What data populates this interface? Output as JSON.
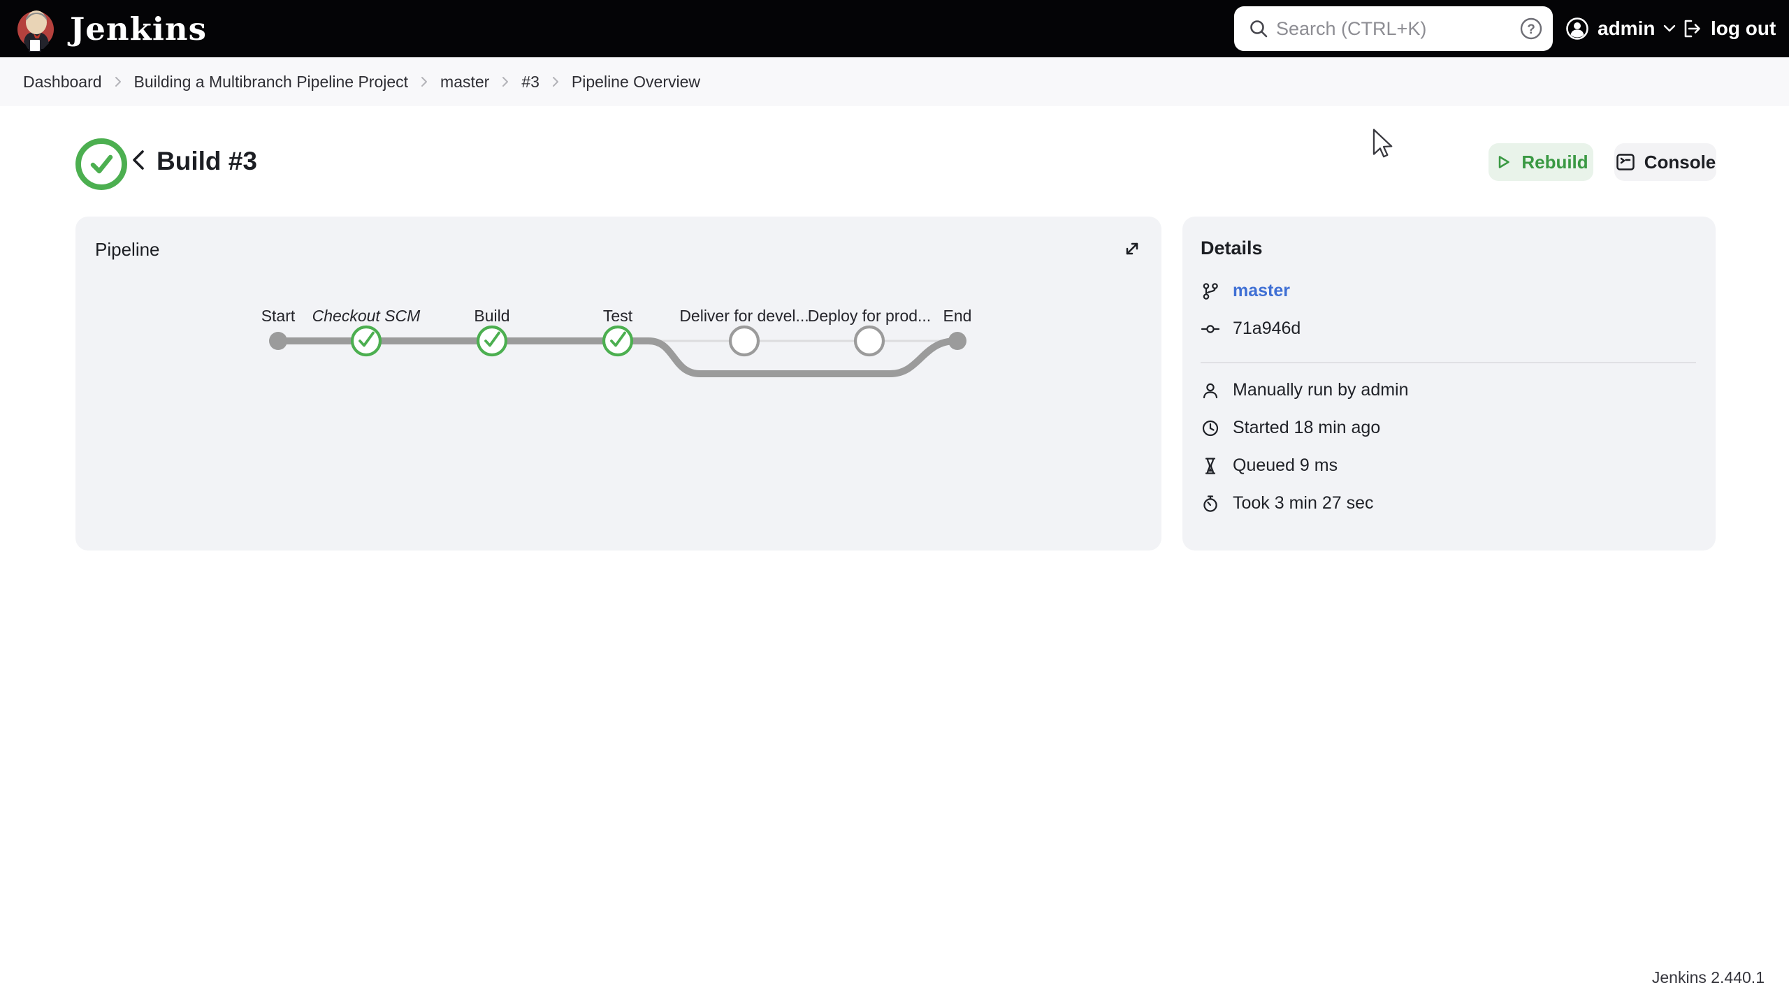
{
  "header": {
    "brand": "Jenkins",
    "search": {
      "placeholder": "Search (CTRL+K)"
    },
    "user": {
      "name": "admin"
    },
    "logout_label": "log out"
  },
  "breadcrumbs": {
    "items": [
      {
        "label": "Dashboard"
      },
      {
        "label": "Building a Multibranch Pipeline Project"
      },
      {
        "label": "master"
      },
      {
        "label": "#3"
      },
      {
        "label": "Pipeline Overview"
      }
    ]
  },
  "page": {
    "title": "Build #3",
    "status": "success",
    "rebuild_label": "Rebuild",
    "console_label": "Console"
  },
  "pipeline": {
    "title": "Pipeline",
    "stages": [
      {
        "label": "Start",
        "type": "terminal"
      },
      {
        "label": "Checkout SCM",
        "status": "success",
        "italic": true
      },
      {
        "label": "Build",
        "status": "success"
      },
      {
        "label": "Test",
        "status": "success"
      },
      {
        "label": "Deliver for devel...",
        "status": "skipped"
      },
      {
        "label": "Deploy for prod...",
        "status": "skipped"
      },
      {
        "label": "End",
        "type": "terminal"
      }
    ]
  },
  "details": {
    "title": "Details",
    "branch": "master",
    "commit": "71a946d",
    "rows": [
      {
        "icon": "user-icon",
        "text": "Manually run by admin"
      },
      {
        "icon": "clock-icon",
        "text": "Started 18 min ago"
      },
      {
        "icon": "hourglass-icon",
        "text": "Queued 9 ms"
      },
      {
        "icon": "stopwatch-icon",
        "text": "Took 3 min 27 sec"
      }
    ]
  },
  "footer": {
    "version": "Jenkins 2.440.1"
  },
  "colors": {
    "header_bg": "#040406",
    "success_green": "#4caf50",
    "rebuild_green": "#3a9943",
    "link_blue": "#3f6fd4",
    "graph_gray": "#9b9b9b",
    "skipped_line_gray": "#dcdcde",
    "card_bg": "#f2f3f6"
  }
}
